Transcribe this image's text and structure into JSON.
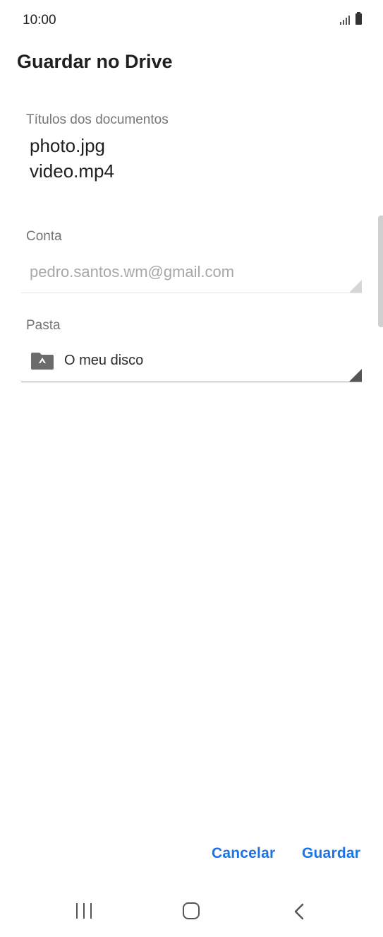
{
  "status_bar": {
    "time": "10:00"
  },
  "header": {
    "title": "Guardar no Drive"
  },
  "documents": {
    "label": "Títulos dos documentos",
    "names_text": "photo.jpg\nvideo.mp4"
  },
  "account": {
    "label": "Conta",
    "value": "pedro.santos.wm@gmail.com"
  },
  "folder": {
    "label": "Pasta",
    "value": "O meu disco",
    "icon": "drive-folder-icon"
  },
  "actions": {
    "cancel_label": "Cancelar",
    "save_label": "Guardar"
  },
  "colors": {
    "accent": "#1a73e8"
  }
}
